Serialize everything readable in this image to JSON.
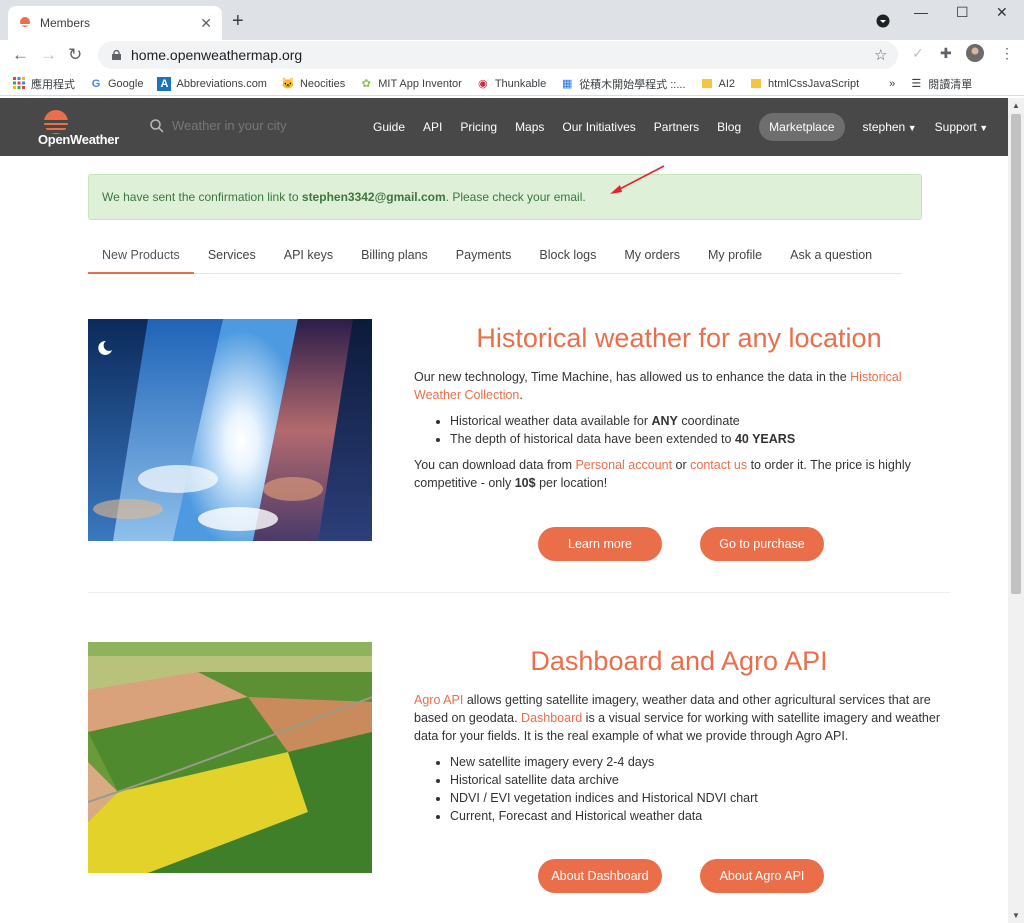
{
  "browser": {
    "tab_title": "Members",
    "url": "home.openweathermap.org",
    "bookmarks": [
      {
        "label": "應用程式",
        "icon": "apps-grid-icon"
      },
      {
        "label": "Google",
        "icon": "google-icon"
      },
      {
        "label": "Abbreviations.com",
        "icon": "abbreviations-icon"
      },
      {
        "label": "Neocities",
        "icon": "neocities-cat-icon"
      },
      {
        "label": "MIT App Inventor",
        "icon": "app-inventor-icon"
      },
      {
        "label": "Thunkable",
        "icon": "thunkable-icon"
      },
      {
        "label": "從積木開始學程式 ::...",
        "icon": "blocks-icon"
      },
      {
        "label": "AI2",
        "icon": "folder-icon"
      },
      {
        "label": "htmlCssJavaScript",
        "icon": "folder-icon"
      }
    ],
    "more_bookmarks": "»",
    "reading_list": "閱讀清單"
  },
  "header": {
    "logo_text": "OpenWeather",
    "search_placeholder": "Weather in your city",
    "nav": [
      "Guide",
      "API",
      "Pricing",
      "Maps",
      "Our Initiatives",
      "Partners",
      "Blog"
    ],
    "marketplace": "Marketplace",
    "user": "stephen",
    "support": "Support"
  },
  "alert": {
    "prefix": "We have sent the confirmation link to ",
    "email": "stephen3342@gmail.com",
    "suffix": ". Please check your email."
  },
  "tabs": [
    "New Products",
    "Services",
    "API keys",
    "Billing plans",
    "Payments",
    "Block logs",
    "My orders",
    "My profile",
    "Ask a question"
  ],
  "section1": {
    "title": "Historical weather for any location",
    "p1_a": "Our new technology, Time Machine, has allowed us to enhance the data in the ",
    "p1_link": "Historical Weather Collection",
    "p1_b": ".",
    "li1_a": "Historical weather data available for ",
    "li1_b": "ANY",
    "li1_c": " coordinate",
    "li2_a": "The depth of historical data have been extended to ",
    "li2_b": "40 YEARS",
    "p2_a": "You can download data from ",
    "p2_link1": "Personal account",
    "p2_b": " or ",
    "p2_link2": "contact us",
    "p2_c": " to order it. The price is highly competitive - only ",
    "p2_d": "10$",
    "p2_e": " per location!",
    "btn1": "Learn more",
    "btn2": "Go to purchase"
  },
  "section2": {
    "title": "Dashboard and Agro API",
    "link1": "Agro API",
    "p_a": " allows getting satellite imagery, weather data and other agricultural services that are based on geodata. ",
    "link2": "Dashboard",
    "p_b": " is a visual service for working with satellite imagery and weather data for your fields. It is the real example of what we provide through Agro API.",
    "bullets": [
      "New satellite imagery every 2-4 days",
      "Historical satellite data archive",
      "NDVI / EVI vegetation indices and Historical NDVI chart",
      "Current, Forecast and Historical weather data"
    ],
    "btn1": "About Dashboard",
    "btn2": "About Agro API"
  },
  "colors": {
    "accent": "#eb6e4b",
    "header_bg": "#484848",
    "alert_bg": "#dff0d8",
    "alert_text": "#3c763d"
  }
}
